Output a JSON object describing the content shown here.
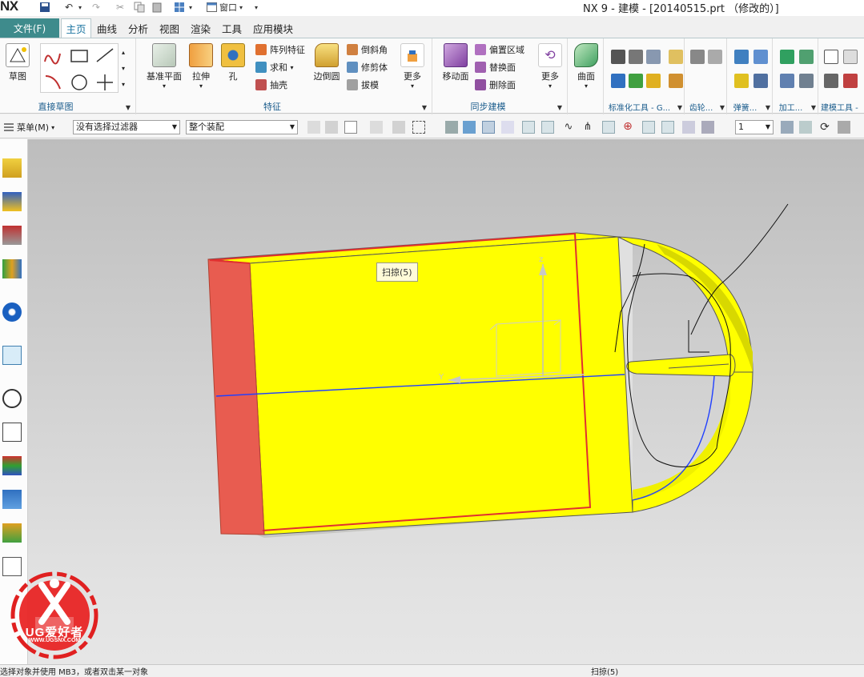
{
  "titlebar": {
    "logo": "NX",
    "window_title": "NX 9 - 建模 - [20140515.prt （修改的）]",
    "window_menu": "窗口"
  },
  "menubar": {
    "file": "文件(F)",
    "tabs": [
      "主页",
      "曲线",
      "分析",
      "视图",
      "渲染",
      "工具",
      "应用模块"
    ]
  },
  "ribbon": {
    "sketch_group": {
      "label": "直接草图",
      "sketch_button": "草图"
    },
    "feature_group": {
      "label": "特征",
      "datum_plane": "基准平面",
      "extrude": "拉伸",
      "hole": "孔",
      "pattern_feature": "阵列特征",
      "unite": "求和",
      "shell": "抽壳",
      "edge_blend": "边倒圆",
      "chamfer": "倒斜角",
      "trim_body": "修剪体",
      "draft": "拔模",
      "more": "更多"
    },
    "sync_group": {
      "label": "同步建模",
      "move_face": "移动面",
      "offset_region": "偏置区域",
      "replace_face": "替换面",
      "delete_face": "删除面",
      "more": "更多"
    },
    "surface": {
      "label": "曲面"
    },
    "small_groups": [
      "标准化工具 - G...",
      "齿轮...",
      "弹簧...",
      "加工...",
      "建模工具 -"
    ]
  },
  "toolbar2": {
    "menu": "菜单(M)",
    "filter": "没有选择过滤器",
    "assembly_scope": "整个装配",
    "layer_value": "1"
  },
  "viewport": {
    "tooltip": "扫掠(5)",
    "axis_x": "X",
    "axis_y": "Y"
  },
  "watermark": {
    "brand": "UG爱好者",
    "url": "WWW.UGSNX.COM"
  },
  "statusbar": {
    "prompt": "选择对象并使用 MB3，或者双击某一对象",
    "selection": "扫掠(5)"
  },
  "colors": {
    "accent": "#3e8b8c",
    "model_yellow": "#ffff00",
    "model_red_face": "#e85c50",
    "selection_edge": "#e03030",
    "sketch_blue": "#2040ff"
  }
}
